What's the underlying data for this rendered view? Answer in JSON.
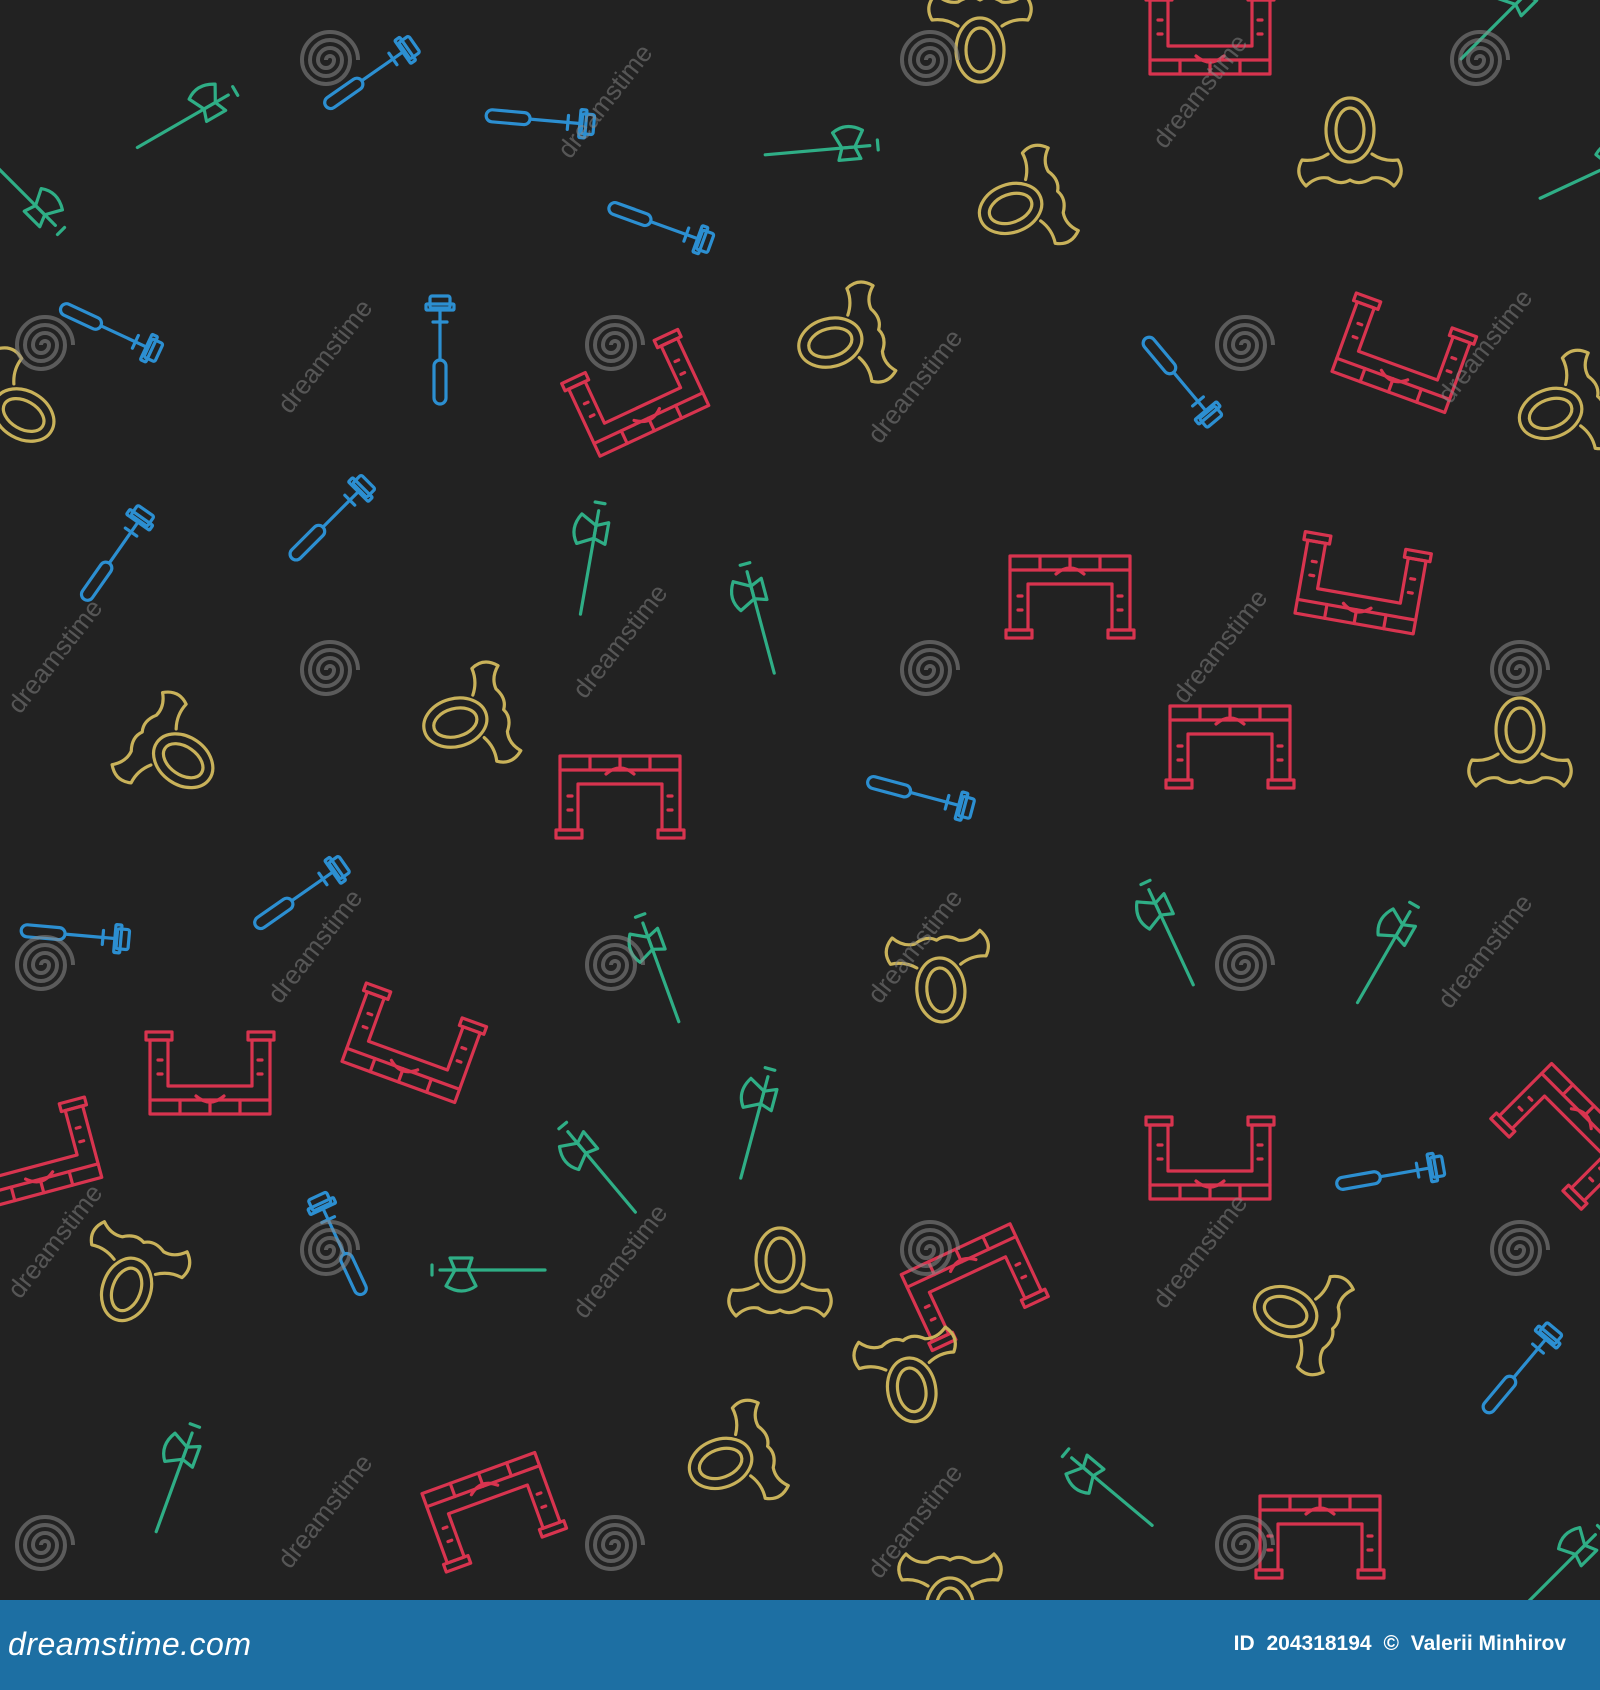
{
  "colors": {
    "background": "#222222",
    "axe": "#2fae86",
    "scepter": "#2c8fd1",
    "gate": "#d8344f",
    "helmet": "#c9b25a",
    "footer": "#1d6fa3"
  },
  "watermark": {
    "text": "dreamstime"
  },
  "footer": {
    "logo": "dreamstime.com",
    "id_label": "ID",
    "id_value": "204318194",
    "copyright": "©",
    "author": "Valerii Minhirov"
  }
}
